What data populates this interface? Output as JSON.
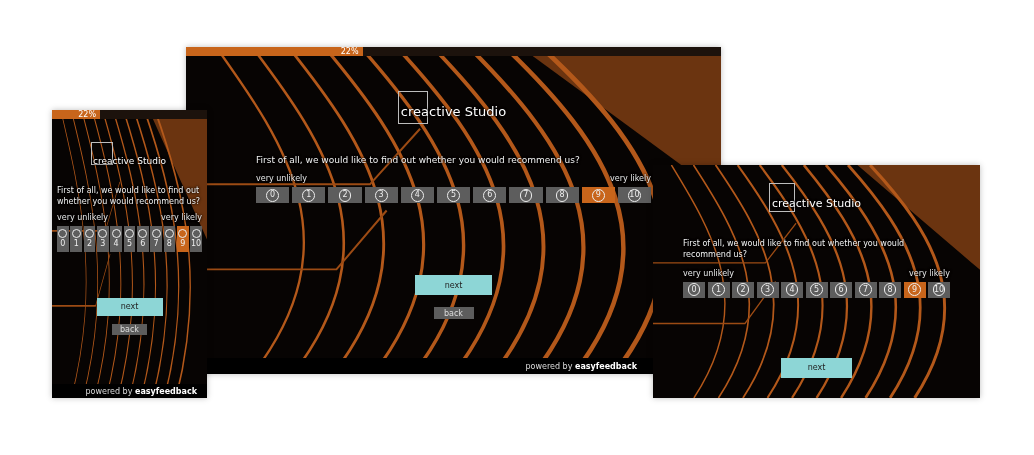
{
  "screens": [
    {
      "kind": "portrait",
      "progress": {
        "level": 0.31,
        "label": "22%"
      },
      "logo": "creactive Studio",
      "question": "First of all, we would like to find out whether you would recommend us?",
      "scale": {
        "low_label": "very unlikely",
        "high_label": "very likely",
        "options": [
          {
            "label": "0",
            "selected": false
          },
          {
            "label": "1",
            "selected": false
          },
          {
            "label": "2",
            "selected": false
          },
          {
            "label": "3",
            "selected": false
          },
          {
            "label": "4",
            "selected": false
          },
          {
            "label": "5",
            "selected": false
          },
          {
            "label": "6",
            "selected": false
          },
          {
            "label": "7",
            "selected": false
          },
          {
            "label": "8",
            "selected": false
          },
          {
            "label": "9",
            "selected": true
          },
          {
            "label": "10",
            "selected": false
          }
        ]
      },
      "next": "next",
      "back": "back",
      "footer": "powered by **easyfeedback**"
    },
    {
      "kind": "landscape",
      "progress": {
        "level": 0.33,
        "label": "22%"
      },
      "logo": "creactive Studio",
      "question": "First of all, we would like to find out whether you would recommend us?",
      "scale": {
        "low_label": "very unlikely",
        "high_label": "very likely",
        "options": [
          {
            "label": "0",
            "selected": false
          },
          {
            "label": "1",
            "selected": false
          },
          {
            "label": "2",
            "selected": false
          },
          {
            "label": "3",
            "selected": false
          },
          {
            "label": "4",
            "selected": false
          },
          {
            "label": "5",
            "selected": false
          },
          {
            "label": "6",
            "selected": false
          },
          {
            "label": "7",
            "selected": false
          },
          {
            "label": "8",
            "selected": false
          },
          {
            "label": "9",
            "selected": true
          },
          {
            "label": "10",
            "selected": false
          }
        ]
      },
      "next": "next",
      "back": "back",
      "footer": "powered by **easyfeedback**"
    },
    {
      "kind": "landscape",
      "logo": "creactive Studio",
      "question": "First of all, we would like to find out whether you would recommend us?",
      "scale": {
        "low_label": "very unlikely",
        "high_label": "very likely",
        "options": [
          {
            "label": "0",
            "selected": false
          },
          {
            "label": "1",
            "selected": false
          },
          {
            "label": "2",
            "selected": false
          },
          {
            "label": "3",
            "selected": false
          },
          {
            "label": "4",
            "selected": false
          },
          {
            "label": "5",
            "selected": false
          },
          {
            "label": "6",
            "selected": false
          },
          {
            "label": "7",
            "selected": false
          },
          {
            "label": "8",
            "selected": false
          },
          {
            "label": "9",
            "selected": true
          },
          {
            "label": "10",
            "selected": false
          }
        ]
      },
      "next": "next"
    }
  ]
}
